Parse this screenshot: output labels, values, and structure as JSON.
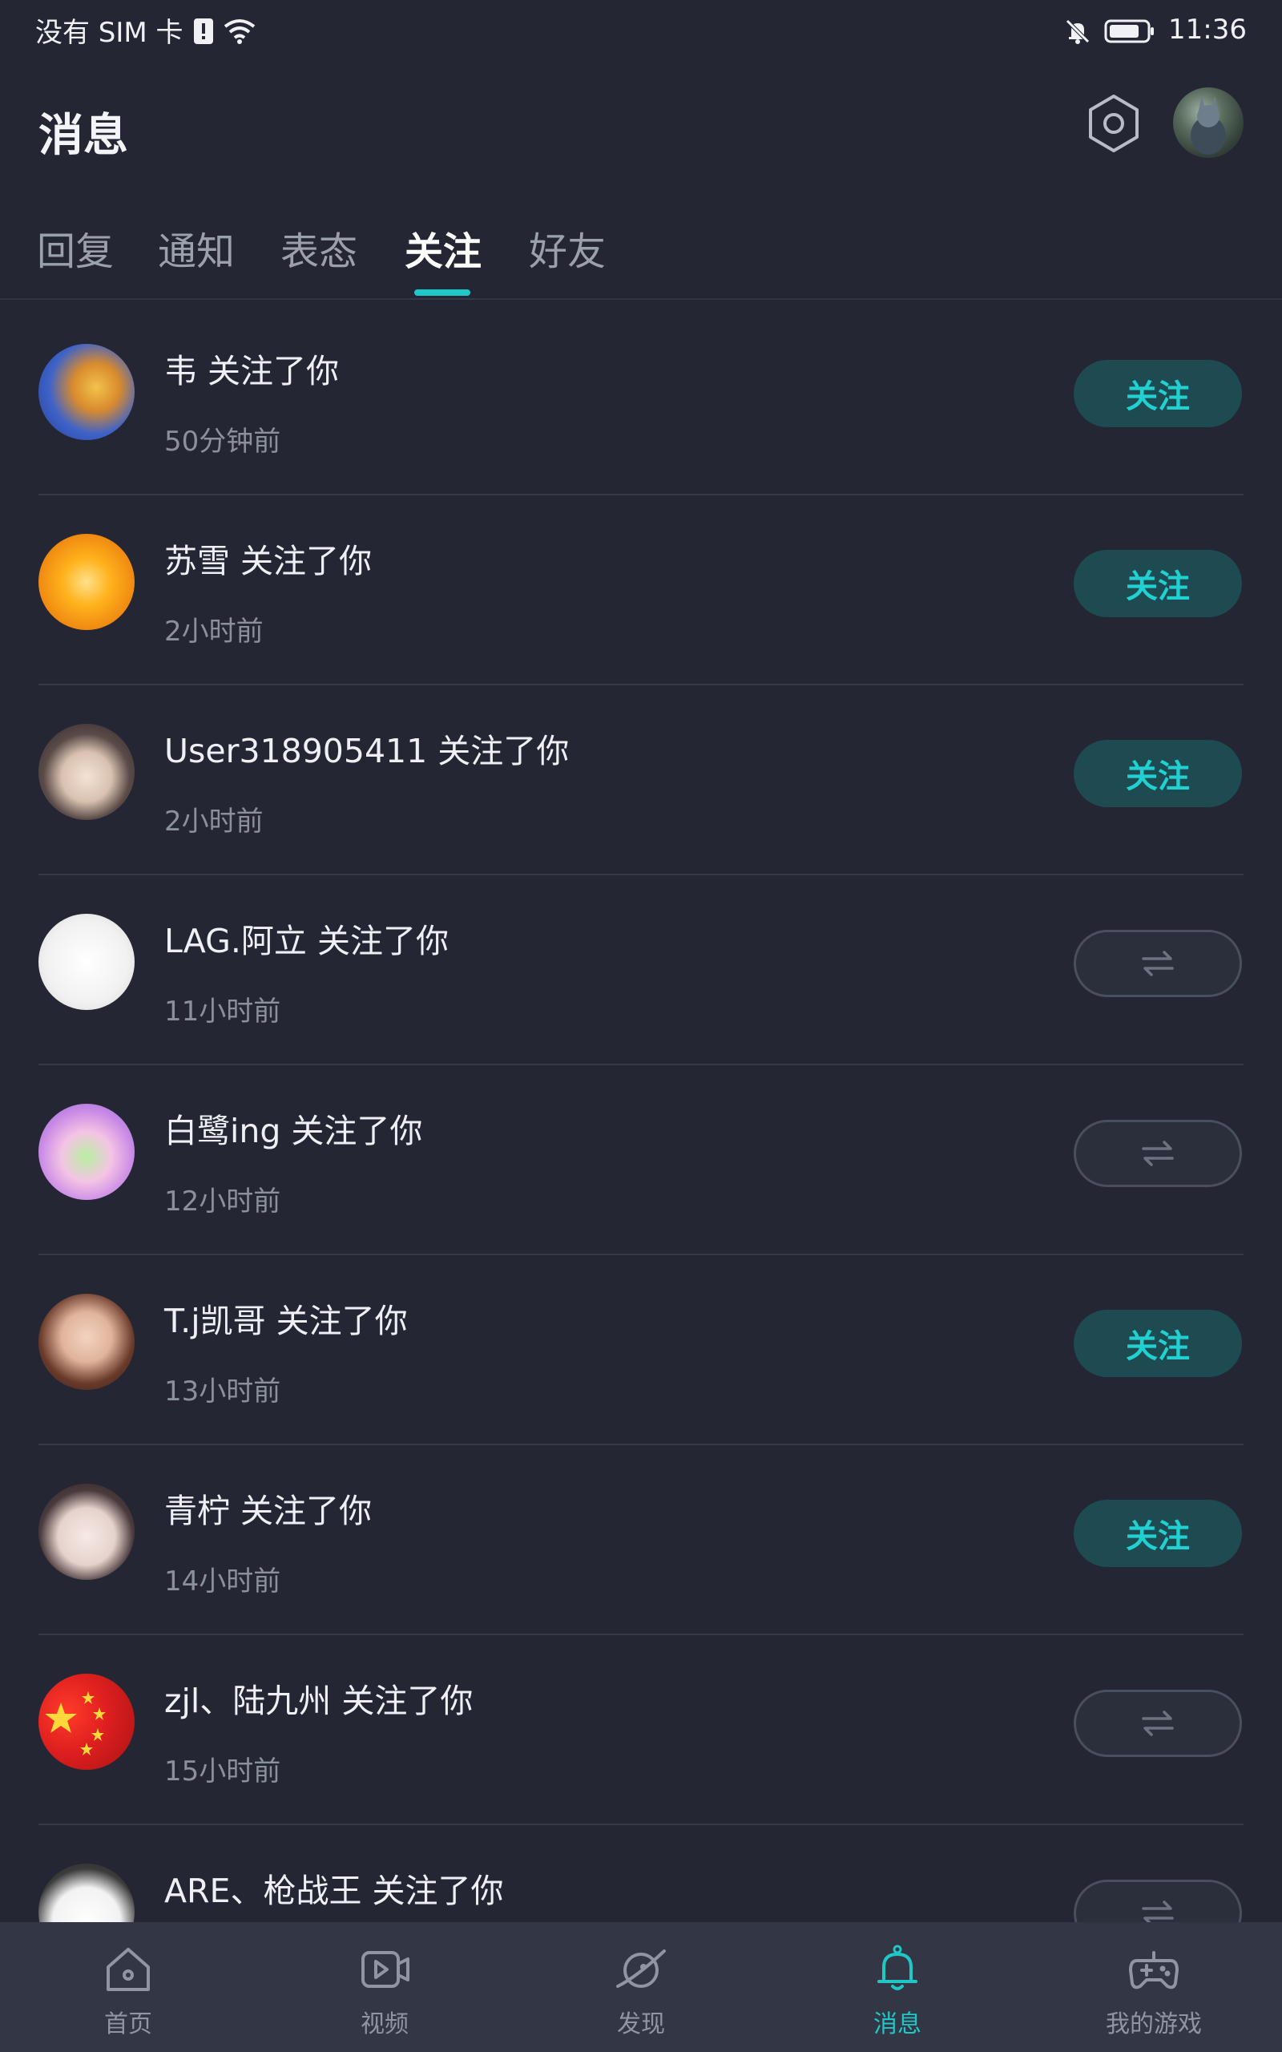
{
  "status_bar": {
    "carrier": "没有 SIM 卡",
    "time": "11:36",
    "icons": [
      "sim-alert-icon",
      "wifi-icon",
      "mute-bell-icon",
      "battery-icon"
    ]
  },
  "header": {
    "title": "消息",
    "icons": [
      "settings-icon",
      "user-avatar"
    ]
  },
  "tabs": [
    {
      "label": "回复"
    },
    {
      "label": "通知"
    },
    {
      "label": "表态"
    },
    {
      "label": "关注",
      "active": true
    },
    {
      "label": "好友"
    }
  ],
  "followers": [
    {
      "name": "韦 关注了你",
      "time": "50分钟前",
      "button": "follow",
      "button_label": "关注"
    },
    {
      "name": "苏雪 关注了你",
      "time": "2小时前",
      "button": "follow",
      "button_label": "关注"
    },
    {
      "name": "User318905411 关注了你",
      "time": "2小时前",
      "button": "follow",
      "button_label": "关注"
    },
    {
      "name": "LAG.阿立 关注了你",
      "time": "11小时前",
      "button": "mutual",
      "button_label": ""
    },
    {
      "name": "白鹭ing 关注了你",
      "time": "12小时前",
      "button": "mutual",
      "button_label": ""
    },
    {
      "name": "T.j凯哥 关注了你",
      "time": "13小时前",
      "button": "follow",
      "button_label": "关注"
    },
    {
      "name": "青柠 关注了你",
      "time": "14小时前",
      "button": "follow",
      "button_label": "关注"
    },
    {
      "name": "zjl、陆九州 关注了你",
      "time": "15小时前",
      "button": "mutual",
      "button_label": ""
    },
    {
      "name": "ARE、枪战王 关注了你",
      "time": "",
      "button": "mutual",
      "button_label": ""
    }
  ],
  "bottom_nav": [
    {
      "label": "首页",
      "icon": "home-icon"
    },
    {
      "label": "视频",
      "icon": "video-icon"
    },
    {
      "label": "发现",
      "icon": "discover-icon"
    },
    {
      "label": "消息",
      "icon": "bell-icon",
      "active": true
    },
    {
      "label": "我的游戏",
      "icon": "gamepad-icon"
    }
  ],
  "colors": {
    "background": "#242733",
    "accent": "#21d0d0",
    "follow_button_bg": "#1e4b52",
    "nav_bg": "#323645"
  }
}
